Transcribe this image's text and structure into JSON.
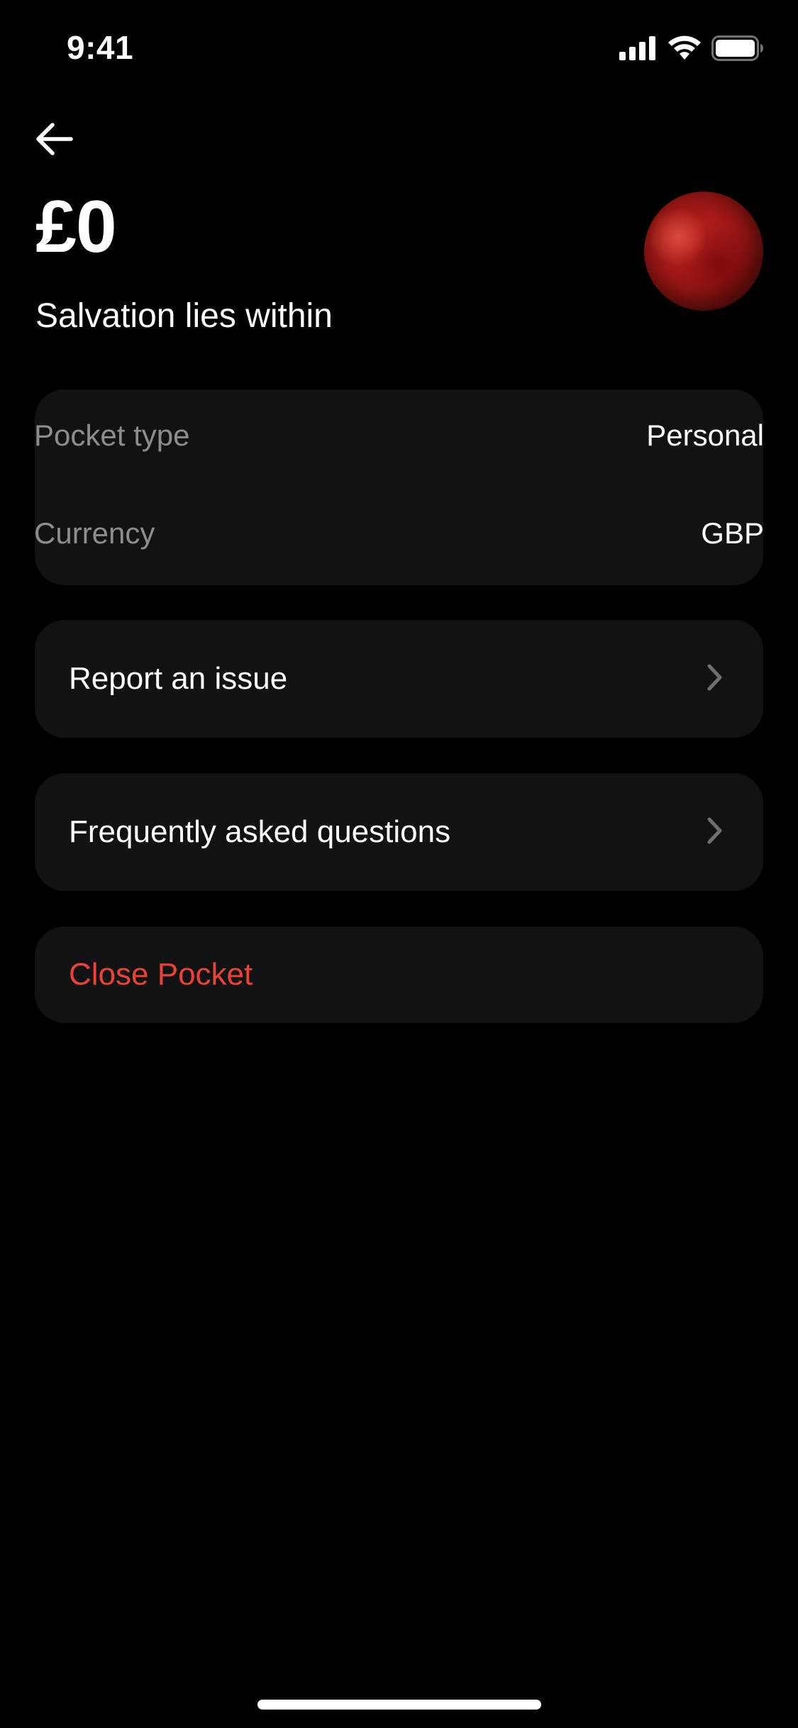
{
  "status_bar": {
    "time": "9:41",
    "signal_icon": "cellular-signal-icon",
    "wifi_icon": "wifi-icon",
    "battery_icon": "battery-icon"
  },
  "header": {
    "back_icon": "arrow-left-icon",
    "balance": "£0",
    "pocket_name": "Salvation lies within",
    "avatar_color": "#b01c1a"
  },
  "details": {
    "rows": [
      {
        "label": "Pocket type",
        "value": "Personal"
      },
      {
        "label": "Currency",
        "value": "GBP"
      }
    ]
  },
  "links": {
    "report_issue": "Report an issue",
    "faq": "Frequently asked questions",
    "chevron_icon": "chevron-right-icon"
  },
  "danger": {
    "close_pocket": "Close Pocket",
    "color": "#ea4335"
  },
  "colors": {
    "background": "#000000",
    "card": "#121214",
    "muted_text": "#8c8c91"
  }
}
